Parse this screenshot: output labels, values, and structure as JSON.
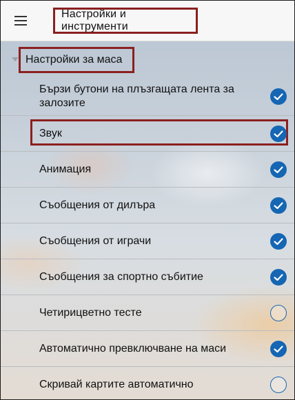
{
  "header": {
    "title": "Настройки и инструменти",
    "menu_icon": "hamburger-menu-icon"
  },
  "section": {
    "title": "Настройки за маса",
    "expand_icon": "chevron-down-icon"
  },
  "settings": [
    {
      "id": "slider-quick-bet-buttons",
      "label": "Бързи бутони на плъзгащата лента за залозите",
      "checked": true
    },
    {
      "id": "sound",
      "label": "Звук",
      "checked": true,
      "highlighted": true
    },
    {
      "id": "animation",
      "label": "Анимация",
      "checked": true
    },
    {
      "id": "dealer-messages",
      "label": "Съобщения от дилъра",
      "checked": true
    },
    {
      "id": "player-messages",
      "label": "Съобщения от играчи",
      "checked": true
    },
    {
      "id": "sports-event-messages",
      "label": "Съобщения за спортно събитие",
      "checked": true
    },
    {
      "id": "four-color-deck",
      "label": "Четирицветно тесте",
      "checked": false
    },
    {
      "id": "auto-switch-tables",
      "label": "Автоматично превключване на маси",
      "checked": true
    },
    {
      "id": "auto-hide-cards",
      "label": "Скривай картите автоматично",
      "checked": false
    }
  ],
  "colors": {
    "accent": "#1566b3",
    "highlight_border": "#8b1f1f"
  }
}
